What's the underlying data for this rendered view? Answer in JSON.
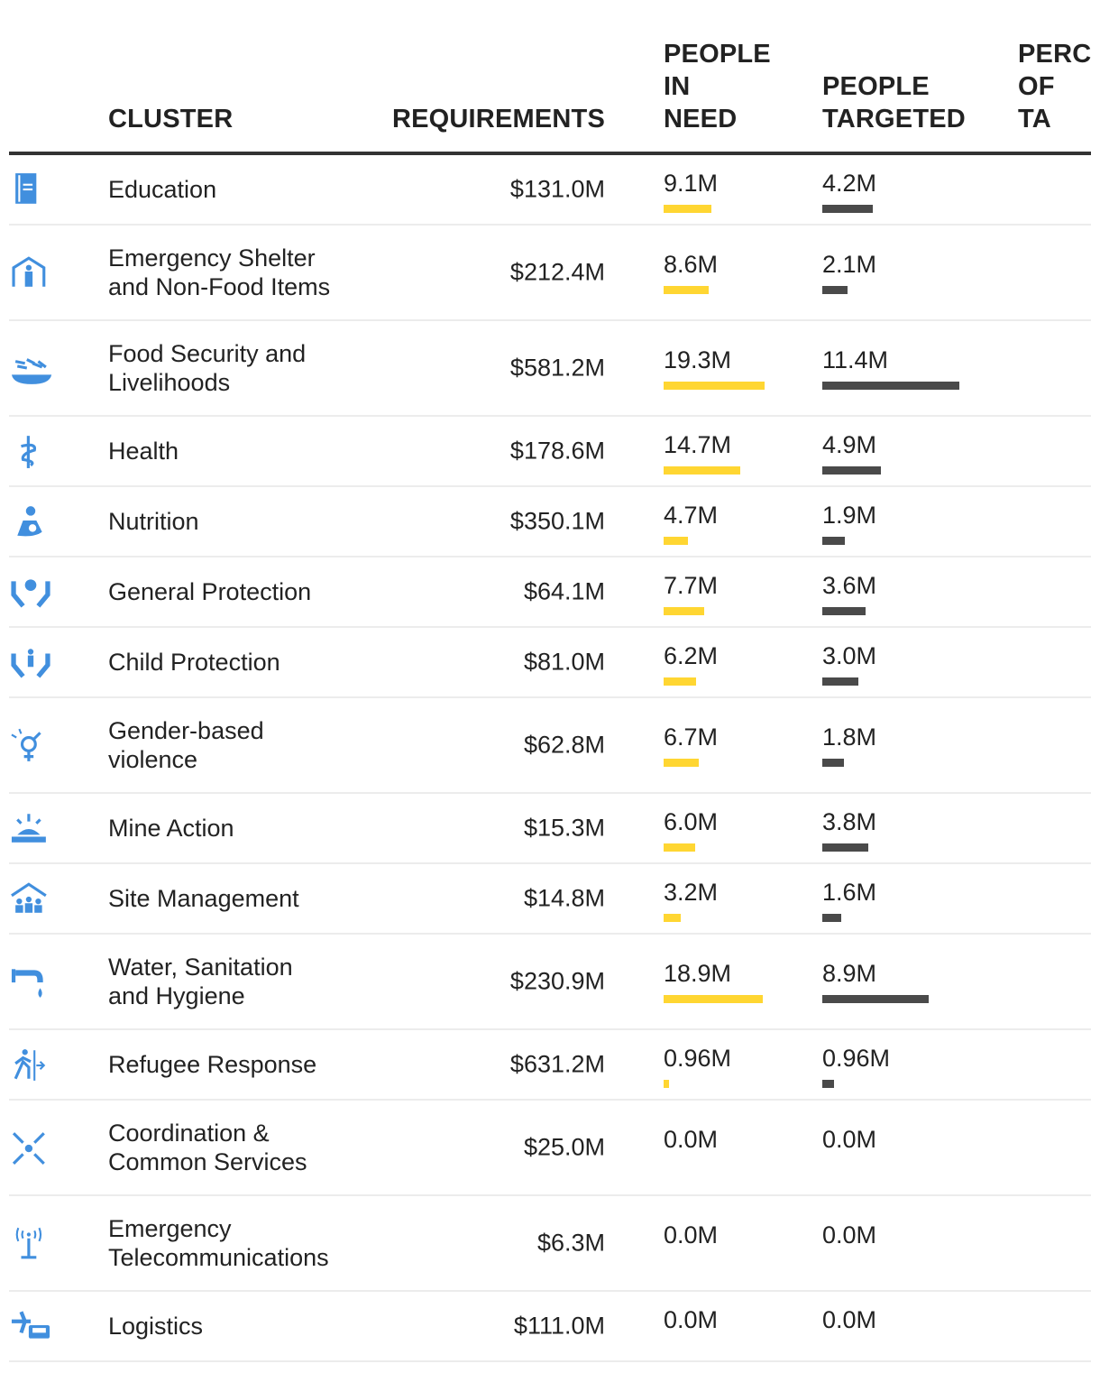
{
  "header": {
    "cluster": "CLUSTER",
    "requirements": "REQUIREMENTS",
    "people_in_need": "PEOPLE\nIN\nNEED",
    "people_targeted": "PEOPLE\nTARGETED",
    "percentage_partial": "PERC\nOF \nTA"
  },
  "colors": {
    "need_bar": "#ffd632",
    "targeted_bar": "#4a4a4a",
    "icon": "#418fde"
  },
  "rows": [
    {
      "cluster": "Education",
      "icon": "book-icon",
      "requirements": "$131.0M",
      "need": "9.1M",
      "need_value": 9.1,
      "targeted": "4.2M",
      "targeted_value": 4.2
    },
    {
      "cluster": "Emergency Shelter\nand Non-Food Items",
      "icon": "shelter-icon",
      "requirements": "$212.4M",
      "need": "8.6M",
      "need_value": 8.6,
      "targeted": "2.1M",
      "targeted_value": 2.1
    },
    {
      "cluster": "Food Security and\nLivelihoods",
      "icon": "food-bowl-icon",
      "requirements": "$581.2M",
      "need": "19.3M",
      "need_value": 19.3,
      "targeted": "11.4M",
      "targeted_value": 11.4
    },
    {
      "cluster": "Health",
      "icon": "health-icon",
      "requirements": "$178.6M",
      "need": "14.7M",
      "need_value": 14.7,
      "targeted": "4.9M",
      "targeted_value": 4.9
    },
    {
      "cluster": "Nutrition",
      "icon": "nutrition-icon",
      "requirements": "$350.1M",
      "need": "4.7M",
      "need_value": 4.7,
      "targeted": "1.9M",
      "targeted_value": 1.9
    },
    {
      "cluster": "General Protection",
      "icon": "protection-icon",
      "requirements": "$64.1M",
      "need": "7.7M",
      "need_value": 7.7,
      "targeted": "3.6M",
      "targeted_value": 3.6
    },
    {
      "cluster": "Child Protection",
      "icon": "child-protection-icon",
      "requirements": "$81.0M",
      "need": "6.2M",
      "need_value": 6.2,
      "targeted": "3.0M",
      "targeted_value": 3.0
    },
    {
      "cluster": "Gender-based\nviolence",
      "icon": "gender-icon",
      "requirements": "$62.8M",
      "need": "6.7M",
      "need_value": 6.7,
      "targeted": "1.8M",
      "targeted_value": 1.8
    },
    {
      "cluster": "Mine Action",
      "icon": "mine-icon",
      "requirements": "$15.3M",
      "need": "6.0M",
      "need_value": 6.0,
      "targeted": "3.8M",
      "targeted_value": 3.8
    },
    {
      "cluster": "Site Management",
      "icon": "camp-icon",
      "requirements": "$14.8M",
      "need": "3.2M",
      "need_value": 3.2,
      "targeted": "1.6M",
      "targeted_value": 1.6
    },
    {
      "cluster": "Water, Sanitation\nand Hygiene",
      "icon": "water-tap-icon",
      "requirements": "$230.9M",
      "need": "18.9M",
      "need_value": 18.9,
      "targeted": "8.9M",
      "targeted_value": 8.9
    },
    {
      "cluster": "Refugee Response",
      "icon": "refugee-icon",
      "requirements": "$631.2M",
      "need": "0.96M",
      "need_value": 0.96,
      "targeted": "0.96M",
      "targeted_value": 0.96
    },
    {
      "cluster": "Coordination &\nCommon Services",
      "icon": "coordination-icon",
      "requirements": "$25.0M",
      "need": "0.0M",
      "need_value": 0,
      "targeted": "0.0M",
      "targeted_value": 0
    },
    {
      "cluster": "Emergency\nTelecommunications",
      "icon": "antenna-icon",
      "requirements": "$6.3M",
      "need": "0.0M",
      "need_value": 0,
      "targeted": "0.0M",
      "targeted_value": 0
    },
    {
      "cluster": "Logistics",
      "icon": "logistics-icon",
      "requirements": "$111.0M",
      "need": "0.0M",
      "need_value": 0,
      "targeted": "0.0M",
      "targeted_value": 0
    }
  ]
}
